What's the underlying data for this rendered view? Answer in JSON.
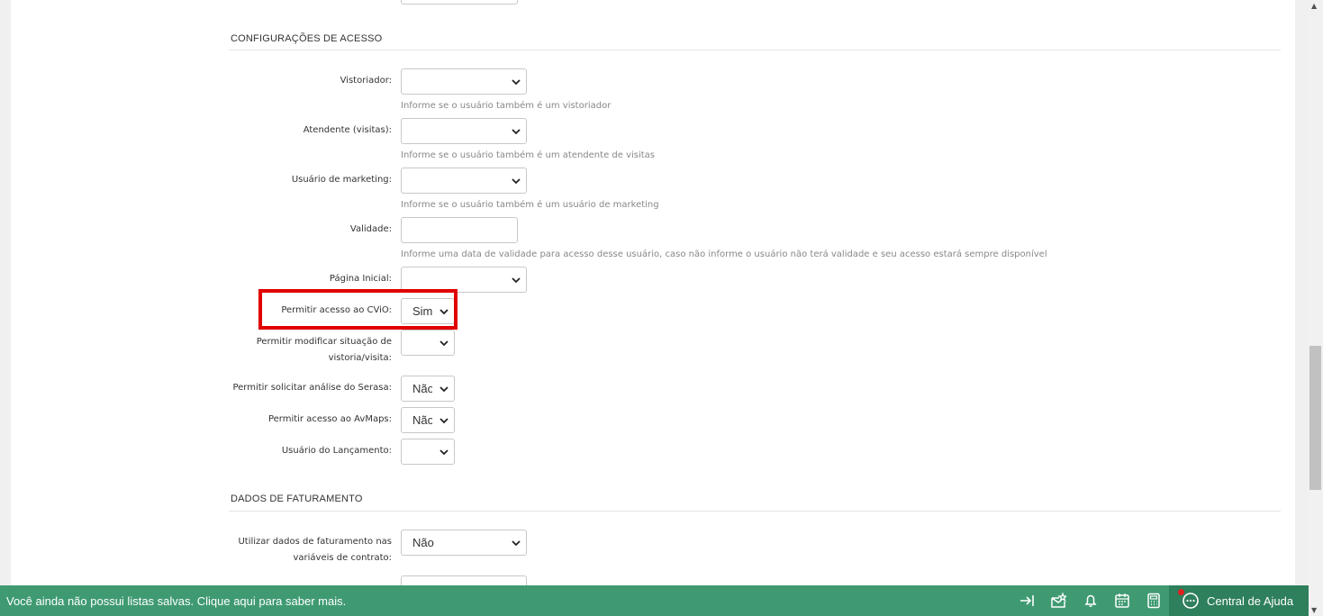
{
  "sections": {
    "access_title": "CONFIGURAÇÕES DE ACESSO",
    "billing_title": "DADOS DE FATURAMENTO"
  },
  "fields": {
    "vistoriador": {
      "label": "Vistoriador:",
      "value": "",
      "help": "Informe se o usuário também é um vistoriador"
    },
    "atendente": {
      "label": "Atendente (visitas):",
      "value": "",
      "help": "Informe se o usuário também é um atendente de visitas"
    },
    "marketing": {
      "label": "Usuário de marketing:",
      "value": "",
      "help": "Informe se o usuário também é um usuário de marketing"
    },
    "validade": {
      "label": "Validade:",
      "value": "",
      "help": "Informe uma data de validade para acesso desse usuário, caso não informe o usuário não terá validade e seu acesso estará sempre disponível"
    },
    "pagina_inicial": {
      "label": "Página Inicial:",
      "value": ""
    },
    "cvio": {
      "label": "Permitir acesso ao CViO:",
      "value": "Sim"
    },
    "modificar_situacao": {
      "label_line1": "Permitir modificar situação de",
      "label_line2": "vistoria/visita:",
      "value": ""
    },
    "serasa": {
      "label": "Permitir solicitar análise do Serasa:",
      "value": "Não"
    },
    "avmaps": {
      "label": "Permitir acesso ao AvMaps:",
      "value": "Não"
    },
    "lancamento": {
      "label": "Usuário do Lançamento:",
      "value": ""
    },
    "faturamento": {
      "label_line1": "Utilizar dados de faturamento nas",
      "label_line2": "variáveis de contrato:",
      "value": "Não"
    }
  },
  "bottom_bar": {
    "message": "Você ainda não possui listas salvas. Clique aqui para saber mais.",
    "help_center": "Central de Ajuda",
    "icons": [
      "collapse-icon",
      "mail-star-icon",
      "bell-icon",
      "calendar-icon",
      "calculator-icon",
      "chat-icon"
    ],
    "bar_color": "#3f9a72",
    "notification_color": "#e02020"
  },
  "colors": {
    "highlight": "#e00000"
  }
}
